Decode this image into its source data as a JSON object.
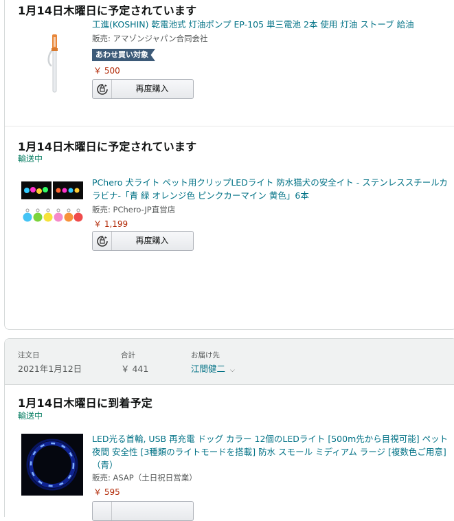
{
  "shipments": [
    {
      "delivery_title": "1月14日木曜日に予定されています",
      "status": "",
      "item": {
        "title": "工進(KOSHIN) 乾電池式 灯油ポンプ EP-105 単三電池 2本 使用 灯油 ストーブ 給油",
        "seller": "販売: アマゾンジャパン合同会社",
        "badge": "あわせ買い対象",
        "price": "￥ 500",
        "rebuy_label": "再度購入",
        "image_icon": "kerosene-pump-icon"
      }
    },
    {
      "delivery_title": "1月14日木曜日に予定されています",
      "status": "輸送中",
      "item": {
        "title": "PChero 犬ライト ペット用クリップLEDライト 防水猫犬の安全イト - ステンレススチールカラビナ-「青 緑 オレンジ色 ピンクカーマイン 黄色」6本",
        "seller": "販売: PChero-JP直営店",
        "price": "￥ 1,199",
        "rebuy_label": "再度購入",
        "image_icon": "led-pet-lights-icon"
      }
    }
  ],
  "order": {
    "order_date_label": "注文日",
    "order_date": "2021年1月12日",
    "total_label": "合計",
    "total": "￥ 441",
    "ship_to_label": "お届け先",
    "ship_to": "江間健二",
    "shipment": {
      "delivery_title": "1月14日木曜日に到着予定",
      "status": "輸送中",
      "item": {
        "title": "LED光る首輪, USB 再充電 ドッグ カラー 12個のLEDライト [500m先から目視可能] ペット 夜間 安全性 [3種類のライトモードを搭載] 防水 スモール ミディアム ラージ [複数色ご用意] （青）",
        "seller": "販売: ASAP（土日祝日営業）",
        "price": "￥ 595",
        "image_icon": "led-collar-icon"
      }
    }
  },
  "colors": {
    "link": "#007185",
    "price": "#b12704",
    "status": "#067d62",
    "badge": "#3c5a78"
  }
}
